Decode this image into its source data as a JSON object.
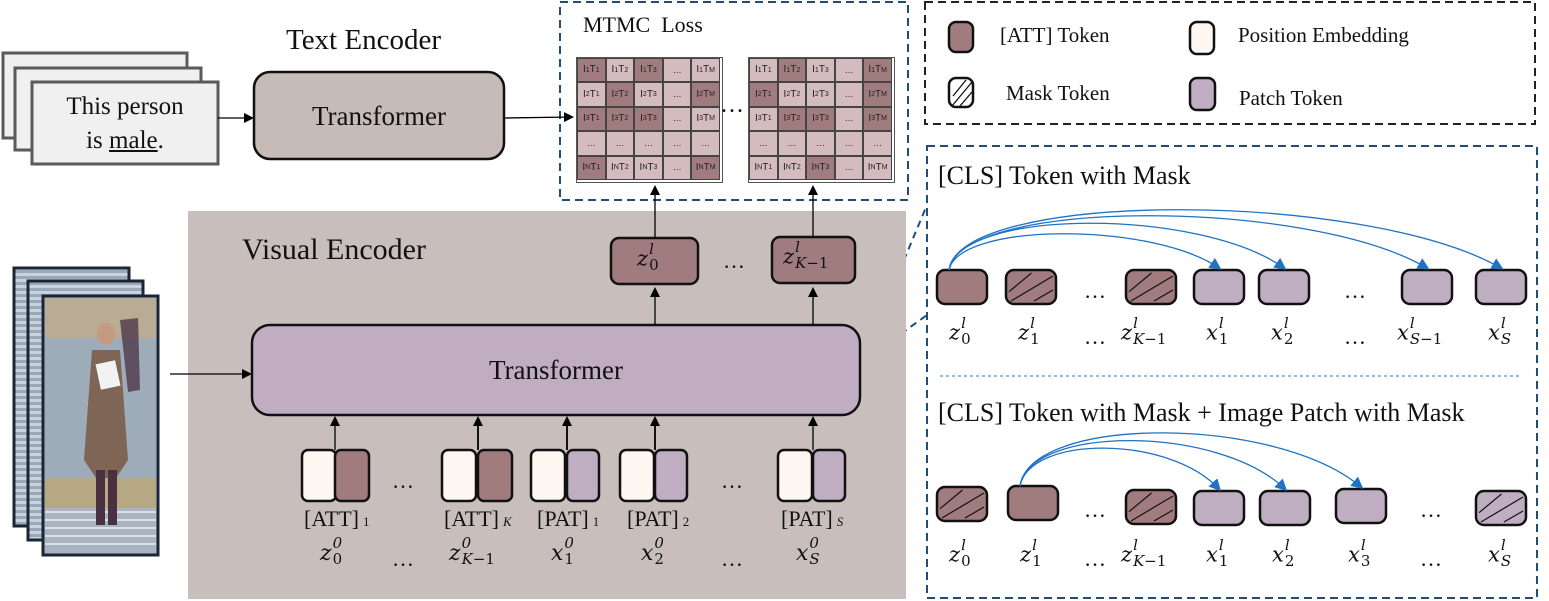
{
  "colors": {
    "att_token": "#a07c7e",
    "position_embedding": "#fdf6f1",
    "patch_token": "#bfadc1",
    "encoder_bg": "#c8bfbc",
    "text_transformer": "#c7bbb8",
    "visual_transformer": "#c0adc2",
    "dashed_border": "#1f4e79",
    "arc_blue": "#1f72c4",
    "matrix_dark": "#a07c7e",
    "matrix_light": "#d4bcbe"
  },
  "text_input": {
    "line1": "This person",
    "line2_prefix": "is ",
    "line2_underlined": "male",
    "line2_suffix": "."
  },
  "text_encoder": {
    "title": "Text Encoder",
    "transformer_label": "Transformer"
  },
  "mtmc": {
    "title": "MTMC  Loss",
    "separator": "…",
    "matrices": [
      {
        "rows": [
          [
            {
              "t": "I1T1",
              "dark": true
            },
            {
              "t": "I1T2",
              "dark": false
            },
            {
              "t": "I1T3",
              "dark": true
            },
            {
              "t": "...",
              "dark": false
            },
            {
              "t": "I1TM",
              "dark": false
            }
          ],
          [
            {
              "t": "I2T1",
              "dark": false
            },
            {
              "t": "I2T2",
              "dark": true
            },
            {
              "t": "I2T3",
              "dark": false
            },
            {
              "t": "...",
              "dark": false
            },
            {
              "t": "I2TM",
              "dark": true
            }
          ],
          [
            {
              "t": "I3T1",
              "dark": true
            },
            {
              "t": "I3T2",
              "dark": true
            },
            {
              "t": "I3T3",
              "dark": true
            },
            {
              "t": "...",
              "dark": false
            },
            {
              "t": "I3TM",
              "dark": false
            }
          ],
          [
            {
              "t": "...",
              "dark": false
            },
            {
              "t": "...",
              "dark": false
            },
            {
              "t": "...",
              "dark": false
            },
            {
              "t": "...",
              "dark": false
            },
            {
              "t": "...",
              "dark": false
            }
          ],
          [
            {
              "t": "INT1",
              "dark": true
            },
            {
              "t": "INT2",
              "dark": false
            },
            {
              "t": "INT3",
              "dark": false
            },
            {
              "t": "...",
              "dark": false
            },
            {
              "t": "INTM",
              "dark": true
            }
          ]
        ]
      },
      {
        "rows": [
          [
            {
              "t": "I1T1",
              "dark": false
            },
            {
              "t": "I1T2",
              "dark": true
            },
            {
              "t": "I1T3",
              "dark": false
            },
            {
              "t": "...",
              "dark": false
            },
            {
              "t": "I1TM",
              "dark": true
            }
          ],
          [
            {
              "t": "I2T1",
              "dark": true
            },
            {
              "t": "I2T2",
              "dark": false
            },
            {
              "t": "I2T3",
              "dark": false
            },
            {
              "t": "...",
              "dark": false
            },
            {
              "t": "I2TM",
              "dark": true
            }
          ],
          [
            {
              "t": "I3T1",
              "dark": false
            },
            {
              "t": "I3T2",
              "dark": true
            },
            {
              "t": "I3T3",
              "dark": true
            },
            {
              "t": "...",
              "dark": false
            },
            {
              "t": "I3TM",
              "dark": true
            }
          ],
          [
            {
              "t": "...",
              "dark": false
            },
            {
              "t": "...",
              "dark": false
            },
            {
              "t": "...",
              "dark": false
            },
            {
              "t": "...",
              "dark": false
            },
            {
              "t": "...",
              "dark": false
            }
          ],
          [
            {
              "t": "INT1",
              "dark": false
            },
            {
              "t": "INT2",
              "dark": false
            },
            {
              "t": "INT3",
              "dark": true
            },
            {
              "t": "...",
              "dark": false
            },
            {
              "t": "INTM",
              "dark": false
            }
          ]
        ]
      }
    ]
  },
  "legend": {
    "items": [
      {
        "label": "[ATT] Token",
        "type": "att"
      },
      {
        "label": "Position Embedding",
        "type": "pos"
      },
      {
        "label": "Mask Token",
        "type": "mask"
      },
      {
        "label": "Patch Token",
        "type": "patch"
      }
    ]
  },
  "visual_encoder": {
    "title": "Visual Encoder",
    "transformer_label": "Transformer",
    "ellipsis": "…",
    "outputs": [
      {
        "base": "z",
        "sup": "l",
        "sub": "0"
      },
      {
        "base": "z",
        "sup": "l",
        "sub": "K−1"
      }
    ],
    "inputs": [
      {
        "kind": "att",
        "tag": "[ATT]",
        "tag_sub": "1",
        "base": "z",
        "sup": "0",
        "sub": "0"
      },
      {
        "kind": "att",
        "tag": "[ATT]",
        "tag_sub": "K",
        "base": "z",
        "sup": "0",
        "sub": "K−1"
      },
      {
        "kind": "patch",
        "tag": "[PAT]",
        "tag_sub": "1",
        "base": "x",
        "sup": "0",
        "sub": "1"
      },
      {
        "kind": "patch",
        "tag": "[PAT]",
        "tag_sub": "2",
        "base": "x",
        "sup": "0",
        "sub": "2"
      },
      {
        "kind": "patch",
        "tag": "[PAT]",
        "tag_sub": "S",
        "base": "x",
        "sup": "0",
        "sub": "S"
      }
    ]
  },
  "panel_cls_mask": {
    "title": "[CLS] Token with Mask",
    "tokens": [
      {
        "kind": "att",
        "masked": false,
        "base": "z",
        "sup": "l",
        "sub": "0"
      },
      {
        "kind": "att",
        "masked": true,
        "base": "z",
        "sup": "l",
        "sub": "1"
      },
      {
        "kind": "ellipsis"
      },
      {
        "kind": "att",
        "masked": true,
        "base": "z",
        "sup": "l",
        "sub": "K−1"
      },
      {
        "kind": "patch",
        "masked": false,
        "base": "x",
        "sup": "l",
        "sub": "1"
      },
      {
        "kind": "patch",
        "masked": false,
        "base": "x",
        "sup": "l",
        "sub": "2"
      },
      {
        "kind": "ellipsis"
      },
      {
        "kind": "patch",
        "masked": false,
        "base": "x",
        "sup": "l",
        "sub": "S−1"
      },
      {
        "kind": "patch",
        "masked": false,
        "base": "x",
        "sup": "l",
        "sub": "S"
      }
    ]
  },
  "panel_cls_patch_mask": {
    "title": "[CLS] Token with Mask + Image Patch with Mask",
    "tokens": [
      {
        "kind": "att",
        "masked": true,
        "base": "z",
        "sup": "l",
        "sub": "0"
      },
      {
        "kind": "att",
        "masked": false,
        "base": "z",
        "sup": "l",
        "sub": "1"
      },
      {
        "kind": "ellipsis"
      },
      {
        "kind": "att",
        "masked": true,
        "base": "z",
        "sup": "l",
        "sub": "K−1"
      },
      {
        "kind": "patch",
        "masked": false,
        "base": "x",
        "sup": "l",
        "sub": "1"
      },
      {
        "kind": "patch",
        "masked": false,
        "base": "x",
        "sup": "l",
        "sub": "2"
      },
      {
        "kind": "patch",
        "masked": false,
        "base": "x",
        "sup": "l",
        "sub": "3"
      },
      {
        "kind": "ellipsis"
      },
      {
        "kind": "patch",
        "masked": true,
        "base": "x",
        "sup": "l",
        "sub": "S"
      }
    ]
  },
  "ellipsis": "…"
}
